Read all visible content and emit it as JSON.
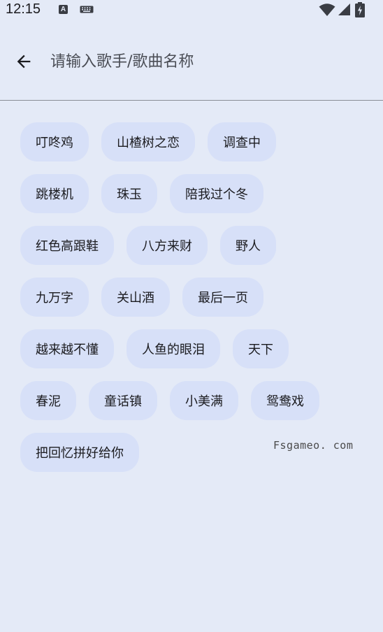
{
  "status_bar": {
    "time": "12:15",
    "a_icon_letter": "A"
  },
  "search": {
    "placeholder": "请输入歌手/歌曲名称"
  },
  "chips": [
    [
      "叮咚鸡",
      "山楂树之恋",
      "调查中"
    ],
    [
      "跳楼机",
      "珠玉",
      "陪我过个冬"
    ],
    [
      "红色高跟鞋",
      "八方来财",
      "野人"
    ],
    [
      "九万字",
      "关山酒",
      "最后一页"
    ],
    [
      "越来越不懂",
      "人鱼的眼泪",
      "天下"
    ],
    [
      "春泥",
      "童话镇",
      "小美满",
      "鸳鸯戏"
    ],
    [
      "把回忆拼好给你"
    ]
  ],
  "watermark": "Fsgameo. com",
  "colors": {
    "background": "#e4eaf7",
    "chip": "#d7e0f8",
    "divider": "#8a8d96"
  }
}
